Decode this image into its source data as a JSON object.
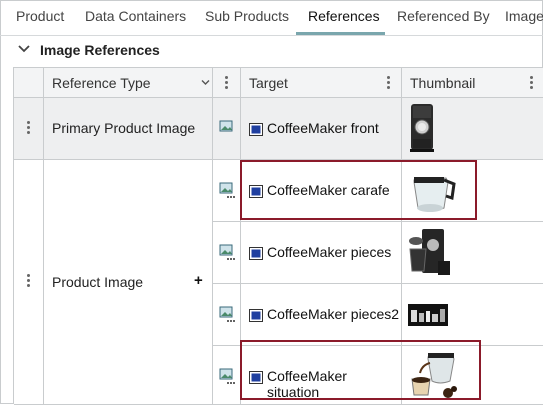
{
  "tabs": [
    {
      "label": "Product"
    },
    {
      "label": "Data Containers"
    },
    {
      "label": "Sub Products"
    },
    {
      "label": "References"
    },
    {
      "label": "Referenced By"
    },
    {
      "label": "Image"
    }
  ],
  "active_tab": "References",
  "section": {
    "title": "Image References"
  },
  "columns": {
    "reference_type": "Reference Type",
    "target": "Target",
    "thumbnail": "Thumbnail"
  },
  "groups": [
    {
      "reference_type": "Primary Product Image"
    },
    {
      "reference_type": "Product Image",
      "add_symbol": "+"
    }
  ],
  "rows": [
    {
      "target": "CoffeeMaker front",
      "highlighted": false
    },
    {
      "target": "CoffeeMaker carafe",
      "highlighted": true
    },
    {
      "target": "CoffeeMaker pieces",
      "highlighted": false
    },
    {
      "target": "CoffeeMaker pieces2",
      "highlighted": false
    },
    {
      "target": "CoffeeMaker situation",
      "highlighted": true
    }
  ],
  "colors": {
    "accent_underline": "#7aa6ad",
    "highlight_border": "#8b1a2a",
    "grey_cell": "#eeeff0"
  },
  "icons": [
    "chevron-down-icon",
    "kebab-icon",
    "image-link-icon",
    "image-file-icon",
    "add-icon"
  ]
}
